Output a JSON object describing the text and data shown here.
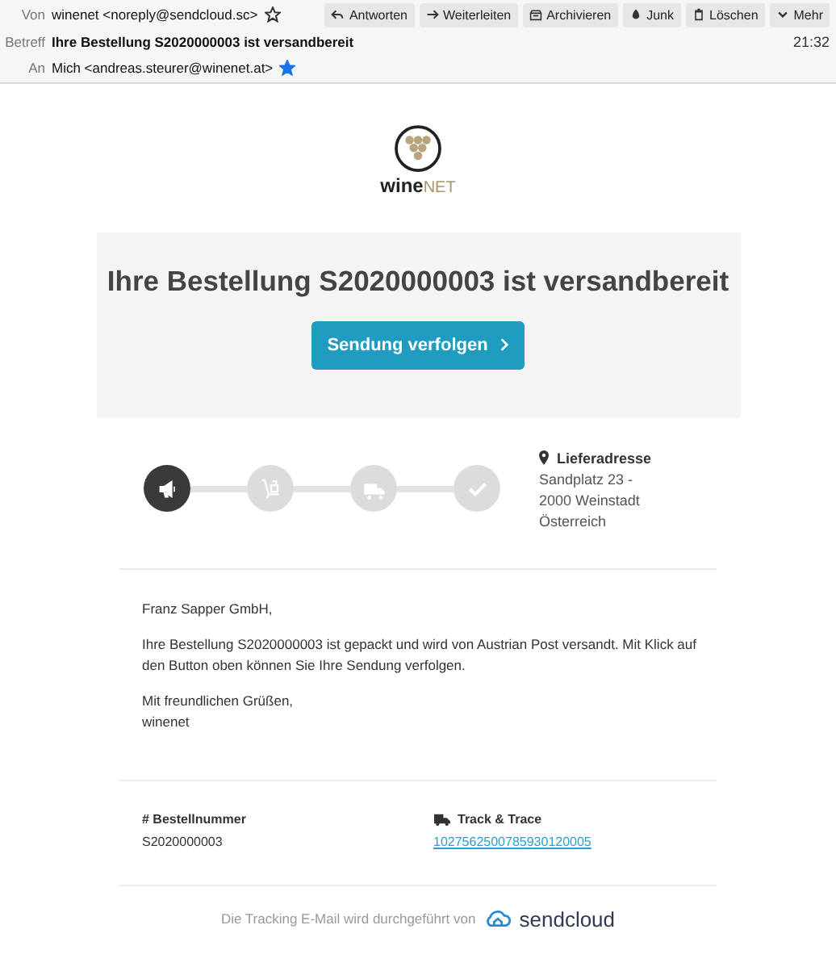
{
  "header": {
    "from_label": "Von",
    "from": "winenet <noreply@sendcloud.sc>",
    "from_starred": false,
    "subject_label": "Betreff",
    "subject": "Ihre Bestellung S2020000003 ist versandbereit",
    "time": "21:32",
    "to_label": "An",
    "to": "Mich <andreas.steurer@winenet.at>",
    "to_starred": true,
    "buttons": [
      {
        "kind": "reply",
        "label": "Antworten"
      },
      {
        "kind": "forward",
        "label": "Weiterleiten"
      },
      {
        "kind": "archive",
        "label": "Archivieren"
      },
      {
        "kind": "junk",
        "label": "Junk"
      },
      {
        "kind": "delete",
        "label": "Löschen"
      },
      {
        "kind": "more",
        "label": "Mehr"
      }
    ]
  },
  "logo": {
    "text_main": "wine",
    "text_accent": "NET"
  },
  "hero": {
    "title": "Ihre Bestellung S2020000003 ist versandbereit",
    "button": "Sendung verfolgen"
  },
  "steps": [
    {
      "kind": "announce",
      "active": true
    },
    {
      "kind": "packing",
      "active": false
    },
    {
      "kind": "truck",
      "active": false
    },
    {
      "kind": "check",
      "active": false
    }
  ],
  "address": {
    "title": "Lieferadresse",
    "lines": [
      "Sandplatz 23 -",
      "2000 Weinstadt",
      "Österreich"
    ]
  },
  "message": [
    "Franz Sapper GmbH,",
    "Ihre Bestellung S2020000003 ist gepackt und wird von Austrian Post versandt. Mit Klick auf den Button oben können Sie Ihre Sendung verfolgen.",
    "Mit freundlichen Grüßen,\nwinenet"
  ],
  "order": {
    "label": "# Bestellnummer",
    "value": "S2020000003"
  },
  "tracking": {
    "label": "Track & Trace",
    "number": "1027562500785930120005"
  },
  "footer": {
    "text": "Die Tracking E-Mail wird durchgeführt von",
    "brand": "sendcloud"
  }
}
